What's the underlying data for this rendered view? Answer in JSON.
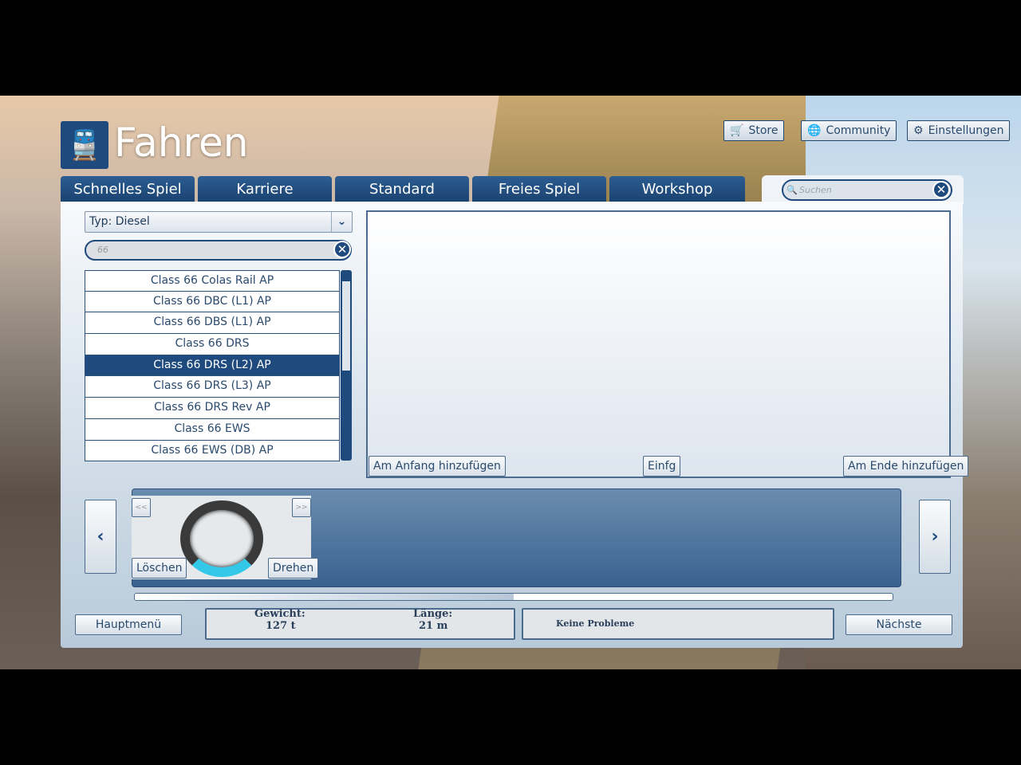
{
  "header": {
    "title": "Fahren",
    "logo_icon": "train-icon"
  },
  "top_buttons": [
    {
      "label": "Store",
      "icon": "cart-icon"
    },
    {
      "label": "Community",
      "icon": "globe-icon"
    },
    {
      "label": "Einstellungen",
      "icon": "gear-icon"
    }
  ],
  "tabs": [
    "Schnelles Spiel",
    "Karriere",
    "Standard",
    "Freies Spiel",
    "Workshop"
  ],
  "search": {
    "placeholder": "Suchen"
  },
  "filter": {
    "type_select": "Typ: Diesel",
    "text": "66"
  },
  "vehicles": [
    "Class 66 Colas Rail AP",
    "Class 66 DBC (L1) AP",
    "Class 66 DBS (L1) AP",
    "Class 66 DRS",
    "Class 66 DRS (L2) AP",
    "Class 66 DRS (L3) AP",
    "Class 66 DRS Rev AP",
    "Class 66 EWS",
    "Class 66 EWS (DB) AP"
  ],
  "selected_index": 4,
  "preview_buttons": {
    "add_start": "Am Anfang hinzufügen",
    "insert": "Einfg",
    "add_end": "Am Ende hinzufügen"
  },
  "consist": {
    "prev": "<<",
    "next": ">>",
    "delete": "Löschen",
    "rotate": "Drehen",
    "scroll_progress": 0.5
  },
  "footer": {
    "main_menu": "Hauptmenü",
    "weight_label": "Gewicht:",
    "weight_value": "127 t",
    "length_label": "Länge:",
    "length_value": "21 m",
    "status": "Keine Probleme",
    "next": "Nächste"
  },
  "colors": {
    "accent": "#1f4a7e"
  }
}
